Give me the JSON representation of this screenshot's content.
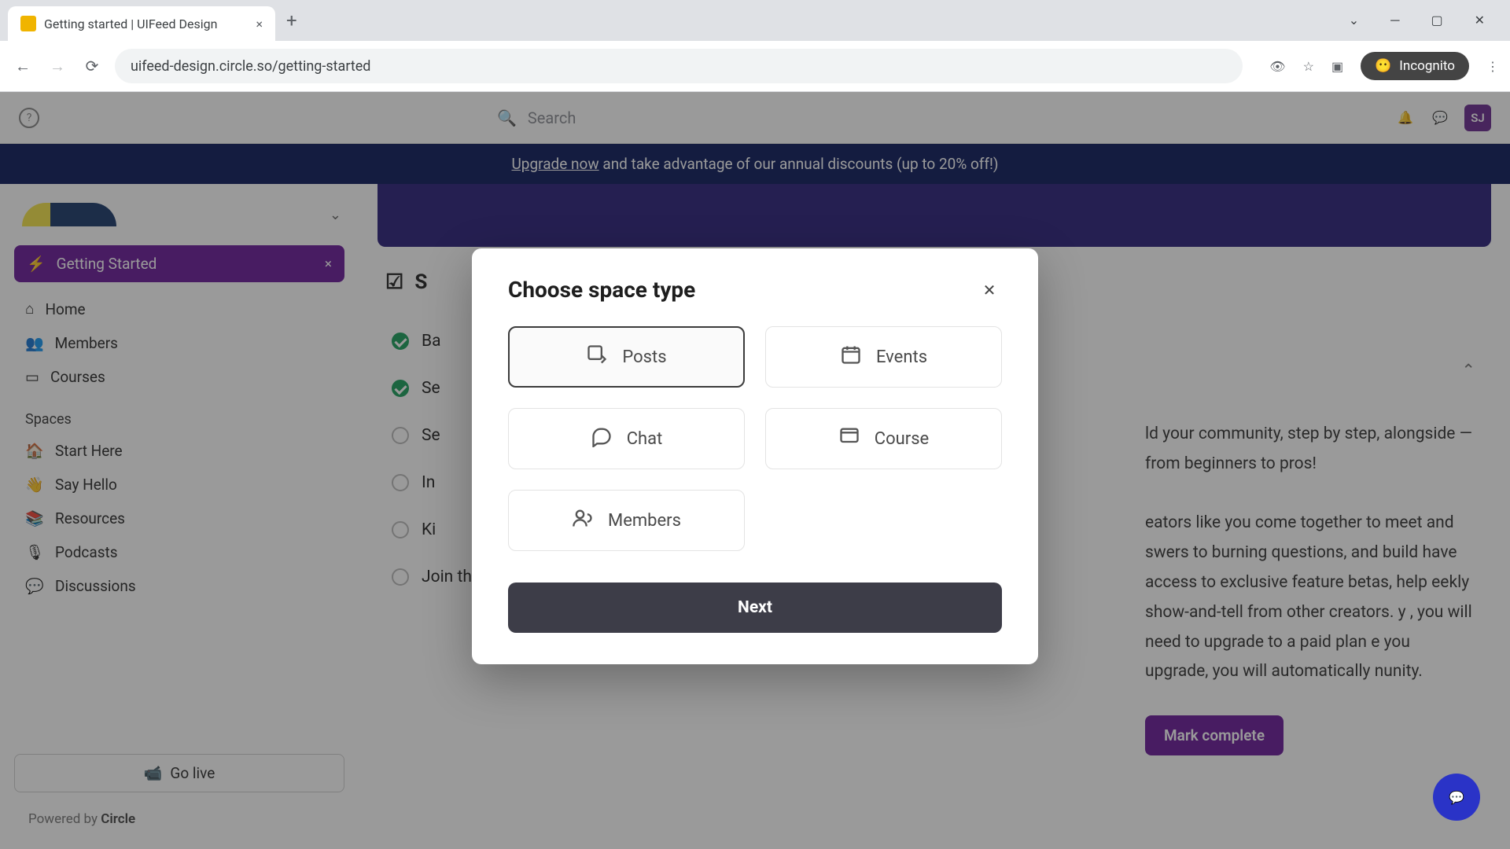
{
  "browser": {
    "tab_title": "Getting started | UIFeed Design",
    "url": "uifeed-design.circle.so/getting-started",
    "incognito_label": "Incognito"
  },
  "header": {
    "search_placeholder": "Search",
    "avatar_initials": "SJ"
  },
  "banner": {
    "link_text": "Upgrade now",
    "rest_text": " and take advantage of our annual discounts (up to 20% off!)"
  },
  "sidebar": {
    "active": "Getting Started",
    "links": [
      "Home",
      "Members",
      "Courses"
    ],
    "section_label": "Spaces",
    "spaces": [
      {
        "emoji": "🏠",
        "label": "Start Here"
      },
      {
        "emoji": "👋",
        "label": "Say Hello"
      },
      {
        "emoji": "📚",
        "label": "Resources"
      },
      {
        "emoji": "🎙",
        "label": "Podcasts"
      },
      {
        "emoji": "💬",
        "label": "Discussions"
      }
    ],
    "go_live": "Go live",
    "powered_prefix": "Powered by ",
    "powered_brand": "Circle"
  },
  "page": {
    "title_prefix": "S",
    "checklist": [
      {
        "done": true,
        "label": "Ba"
      },
      {
        "done": true,
        "label": "Se"
      },
      {
        "done": false,
        "label": "Se"
      },
      {
        "done": false,
        "label": "In"
      },
      {
        "done": false,
        "label": "Ki"
      },
      {
        "done": false,
        "label": "Join the Circle community"
      }
    ],
    "right_text": "ld your community, step by step, alongside — from beginners to pros!\n\neators like you come together to meet and swers to burning questions, and build have access to exclusive feature betas, help eekly show-and-tell from other creators. y , you will need to upgrade to a paid plan e you upgrade, you will automatically nunity.",
    "mark_complete": "Mark complete"
  },
  "modal": {
    "title": "Choose space type",
    "types": [
      "Posts",
      "Events",
      "Chat",
      "Course",
      "Members"
    ],
    "selected": 0,
    "next": "Next"
  }
}
